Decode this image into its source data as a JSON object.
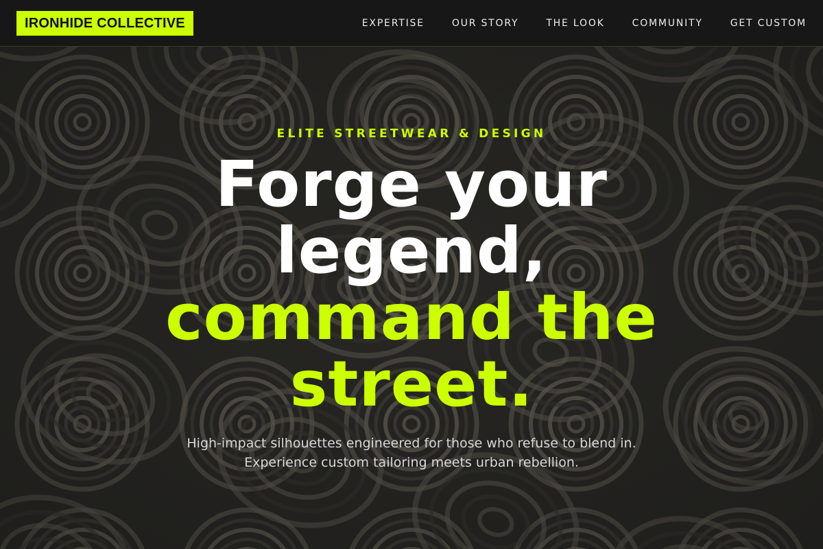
{
  "brand": {
    "name": "IRONHIDE COLLECTIVE",
    "accent_color": "#ccff00"
  },
  "nav": {
    "items": [
      {
        "label": "EXPERTISE"
      },
      {
        "label": "OUR STORY"
      },
      {
        "label": "THE LOOK"
      },
      {
        "label": "COMMUNITY"
      },
      {
        "label": "GET CUSTOM"
      }
    ]
  },
  "hero": {
    "eyebrow": "ELITE STREETWEAR & DESIGN",
    "headline_line1": "Forge your",
    "headline_line2": "legend,",
    "headline_accent_line1": "command the",
    "headline_accent_line2": "street.",
    "subtitle": "High-impact silhouettes engineered for those who refuse to blend in. Experience custom tailoring meets urban rebellion.",
    "background_image": "rolled-fabric-texture",
    "headline_color": "#ffffff",
    "accent_color": "#ccff00"
  }
}
